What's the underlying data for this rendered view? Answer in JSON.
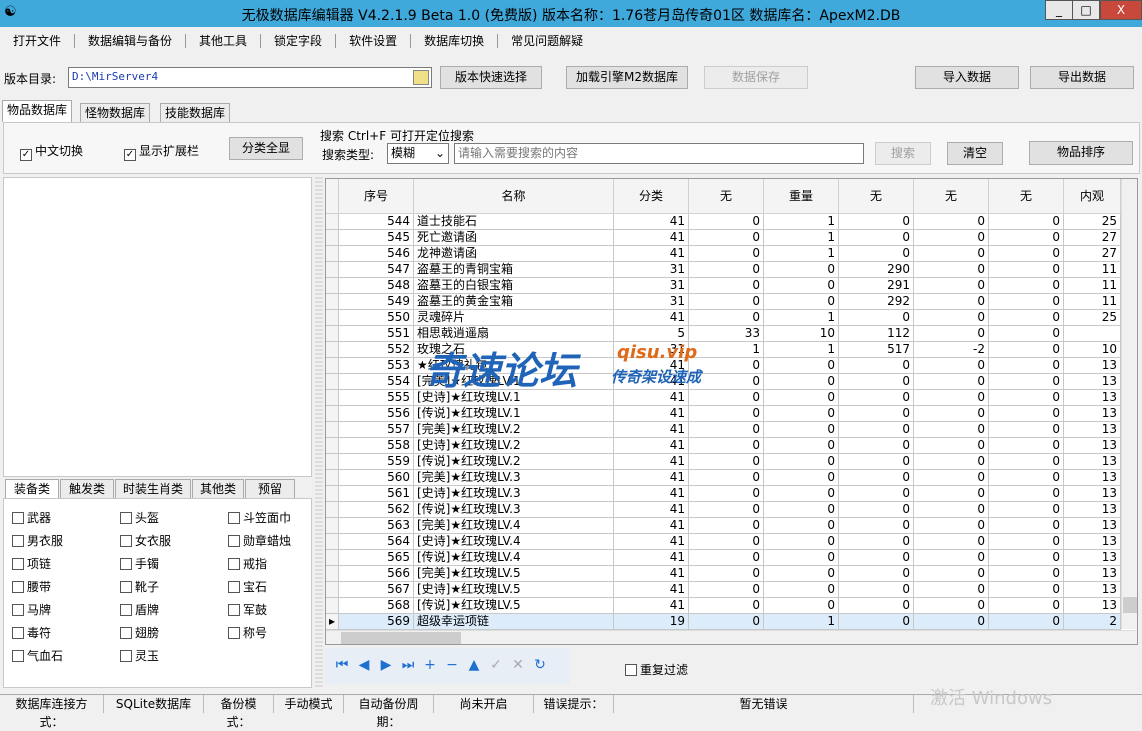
{
  "title": "无极数据库编辑器 V4.2.1.9   Beta 1.0 (免费版)    版本名称：1.76苍月岛传奇01区    数据库名：ApexM2.DB",
  "window_buttons": {
    "minimize": "_",
    "maximize": "□",
    "close": "X"
  },
  "menu": [
    "打开文件",
    "数据编辑与备份",
    "其他工具",
    "锁定字段",
    "软件设置",
    "数据库切换",
    "常见问题解疑"
  ],
  "toolbar": {
    "dir_label": "版本目录:",
    "dir_value": "D:\\MirServer4",
    "quick_select": "版本快速选择",
    "load_m2": "加载引擎M2数据库",
    "save": "数据保存",
    "import": "导入数据",
    "export": "导出数据"
  },
  "tabs": [
    "物品数据库",
    "怪物数据库",
    "技能数据库"
  ],
  "options": {
    "chinese": "中文切换",
    "show_ext": "显示扩展栏",
    "show_all": "分类全显",
    "search_hint": "搜索  Ctrl+F 可打开定位搜索",
    "search_type_label": "搜索类型:",
    "search_type": "模糊",
    "search_placeholder": "请输入需要搜索的内容",
    "search_btn": "搜索",
    "clear_btn": "清空",
    "sort_btn": "物品排序"
  },
  "category_tabs": [
    "装备类",
    "触发类",
    "时装生肖类",
    "其他类",
    "预留"
  ],
  "categories": [
    "武器",
    "头盔",
    "斗笠面巾",
    "男衣服",
    "女衣服",
    "勋章蜡烛",
    "项链",
    "手镯",
    "戒指",
    "腰带",
    "靴子",
    "宝石",
    "马牌",
    "盾牌",
    "军鼓",
    "毒符",
    "翅膀",
    "称号",
    "气血石",
    "灵玉"
  ],
  "grid": {
    "columns": [
      "序号",
      "名称",
      "分类",
      "无",
      "重量",
      "无",
      "无",
      "无",
      "内观"
    ],
    "rows": [
      [
        "544",
        "道士技能石",
        "41",
        "0",
        "1",
        "0",
        "0",
        "0",
        "25"
      ],
      [
        "545",
        "死亡邀请函",
        "41",
        "0",
        "1",
        "0",
        "0",
        "0",
        "27"
      ],
      [
        "546",
        "龙神邀请函",
        "41",
        "0",
        "1",
        "0",
        "0",
        "0",
        "27"
      ],
      [
        "547",
        "盗墓王的青铜宝箱",
        "31",
        "0",
        "0",
        "290",
        "0",
        "0",
        "11"
      ],
      [
        "548",
        "盗墓王的白银宝箱",
        "31",
        "0",
        "0",
        "291",
        "0",
        "0",
        "11"
      ],
      [
        "549",
        "盗墓王的黄金宝箱",
        "31",
        "0",
        "0",
        "292",
        "0",
        "0",
        "11"
      ],
      [
        "550",
        "灵魂碎片",
        "41",
        "0",
        "1",
        "0",
        "0",
        "0",
        "25"
      ],
      [
        "551",
        "相思戟逍遥扇",
        "5",
        "33",
        "10",
        "112",
        "0",
        "0",
        ""
      ],
      [
        "552",
        "玫瑰之石",
        "31",
        "1",
        "1",
        "517",
        "-2",
        "0",
        "10"
      ],
      [
        "553",
        "★红玫瑰礼包",
        "41",
        "0",
        "0",
        "0",
        "0",
        "0",
        "13"
      ],
      [
        "554",
        "[完美]★红玫瑰LV.1",
        "41",
        "0",
        "0",
        "0",
        "0",
        "0",
        "13"
      ],
      [
        "555",
        "[史诗]★红玫瑰LV.1",
        "41",
        "0",
        "0",
        "0",
        "0",
        "0",
        "13"
      ],
      [
        "556",
        "[传说]★红玫瑰LV.1",
        "41",
        "0",
        "0",
        "0",
        "0",
        "0",
        "13"
      ],
      [
        "557",
        "[完美]★红玫瑰LV.2",
        "41",
        "0",
        "0",
        "0",
        "0",
        "0",
        "13"
      ],
      [
        "558",
        "[史诗]★红玫瑰LV.2",
        "41",
        "0",
        "0",
        "0",
        "0",
        "0",
        "13"
      ],
      [
        "559",
        "[传说]★红玫瑰LV.2",
        "41",
        "0",
        "0",
        "0",
        "0",
        "0",
        "13"
      ],
      [
        "560",
        "[完美]★红玫瑰LV.3",
        "41",
        "0",
        "0",
        "0",
        "0",
        "0",
        "13"
      ],
      [
        "561",
        "[史诗]★红玫瑰LV.3",
        "41",
        "0",
        "0",
        "0",
        "0",
        "0",
        "13"
      ],
      [
        "562",
        "[传说]★红玫瑰LV.3",
        "41",
        "0",
        "0",
        "0",
        "0",
        "0",
        "13"
      ],
      [
        "563",
        "[完美]★红玫瑰LV.4",
        "41",
        "0",
        "0",
        "0",
        "0",
        "0",
        "13"
      ],
      [
        "564",
        "[史诗]★红玫瑰LV.4",
        "41",
        "0",
        "0",
        "0",
        "0",
        "0",
        "13"
      ],
      [
        "565",
        "[传说]★红玫瑰LV.4",
        "41",
        "0",
        "0",
        "0",
        "0",
        "0",
        "13"
      ],
      [
        "566",
        "[完美]★红玫瑰LV.5",
        "41",
        "0",
        "0",
        "0",
        "0",
        "0",
        "13"
      ],
      [
        "567",
        "[史诗]★红玫瑰LV.5",
        "41",
        "0",
        "0",
        "0",
        "0",
        "0",
        "13"
      ],
      [
        "568",
        "[传说]★红玫瑰LV.5",
        "41",
        "0",
        "0",
        "0",
        "0",
        "0",
        "13"
      ],
      [
        "569",
        "超级幸运项链",
        "19",
        "0",
        "1",
        "0",
        "0",
        "0",
        "2"
      ]
    ],
    "selected_row": "569"
  },
  "nav_icons": [
    "first-icon",
    "prev-icon",
    "next-icon",
    "last-icon",
    "add-icon",
    "delete-icon",
    "up-icon",
    "confirm-icon",
    "cancel-icon",
    "refresh-icon"
  ],
  "dup_filter": "重复过滤",
  "status": [
    "数据库连接方式：",
    "SQLite数据库",
    "备份模式：",
    "手动模式",
    "自动备份周期：",
    "尚未开启",
    "错误提示：",
    "暂无错误"
  ],
  "watermark": {
    "logo": "奇速论坛",
    "url": "qisu.vip",
    "tagline": "传奇架设速成",
    "os": "激活 Windows"
  },
  "colors": {
    "titlebar": "#3fa9dc",
    "close": "#c9483c",
    "nav": "#1e6fd0",
    "selected": "#dcecfb"
  }
}
